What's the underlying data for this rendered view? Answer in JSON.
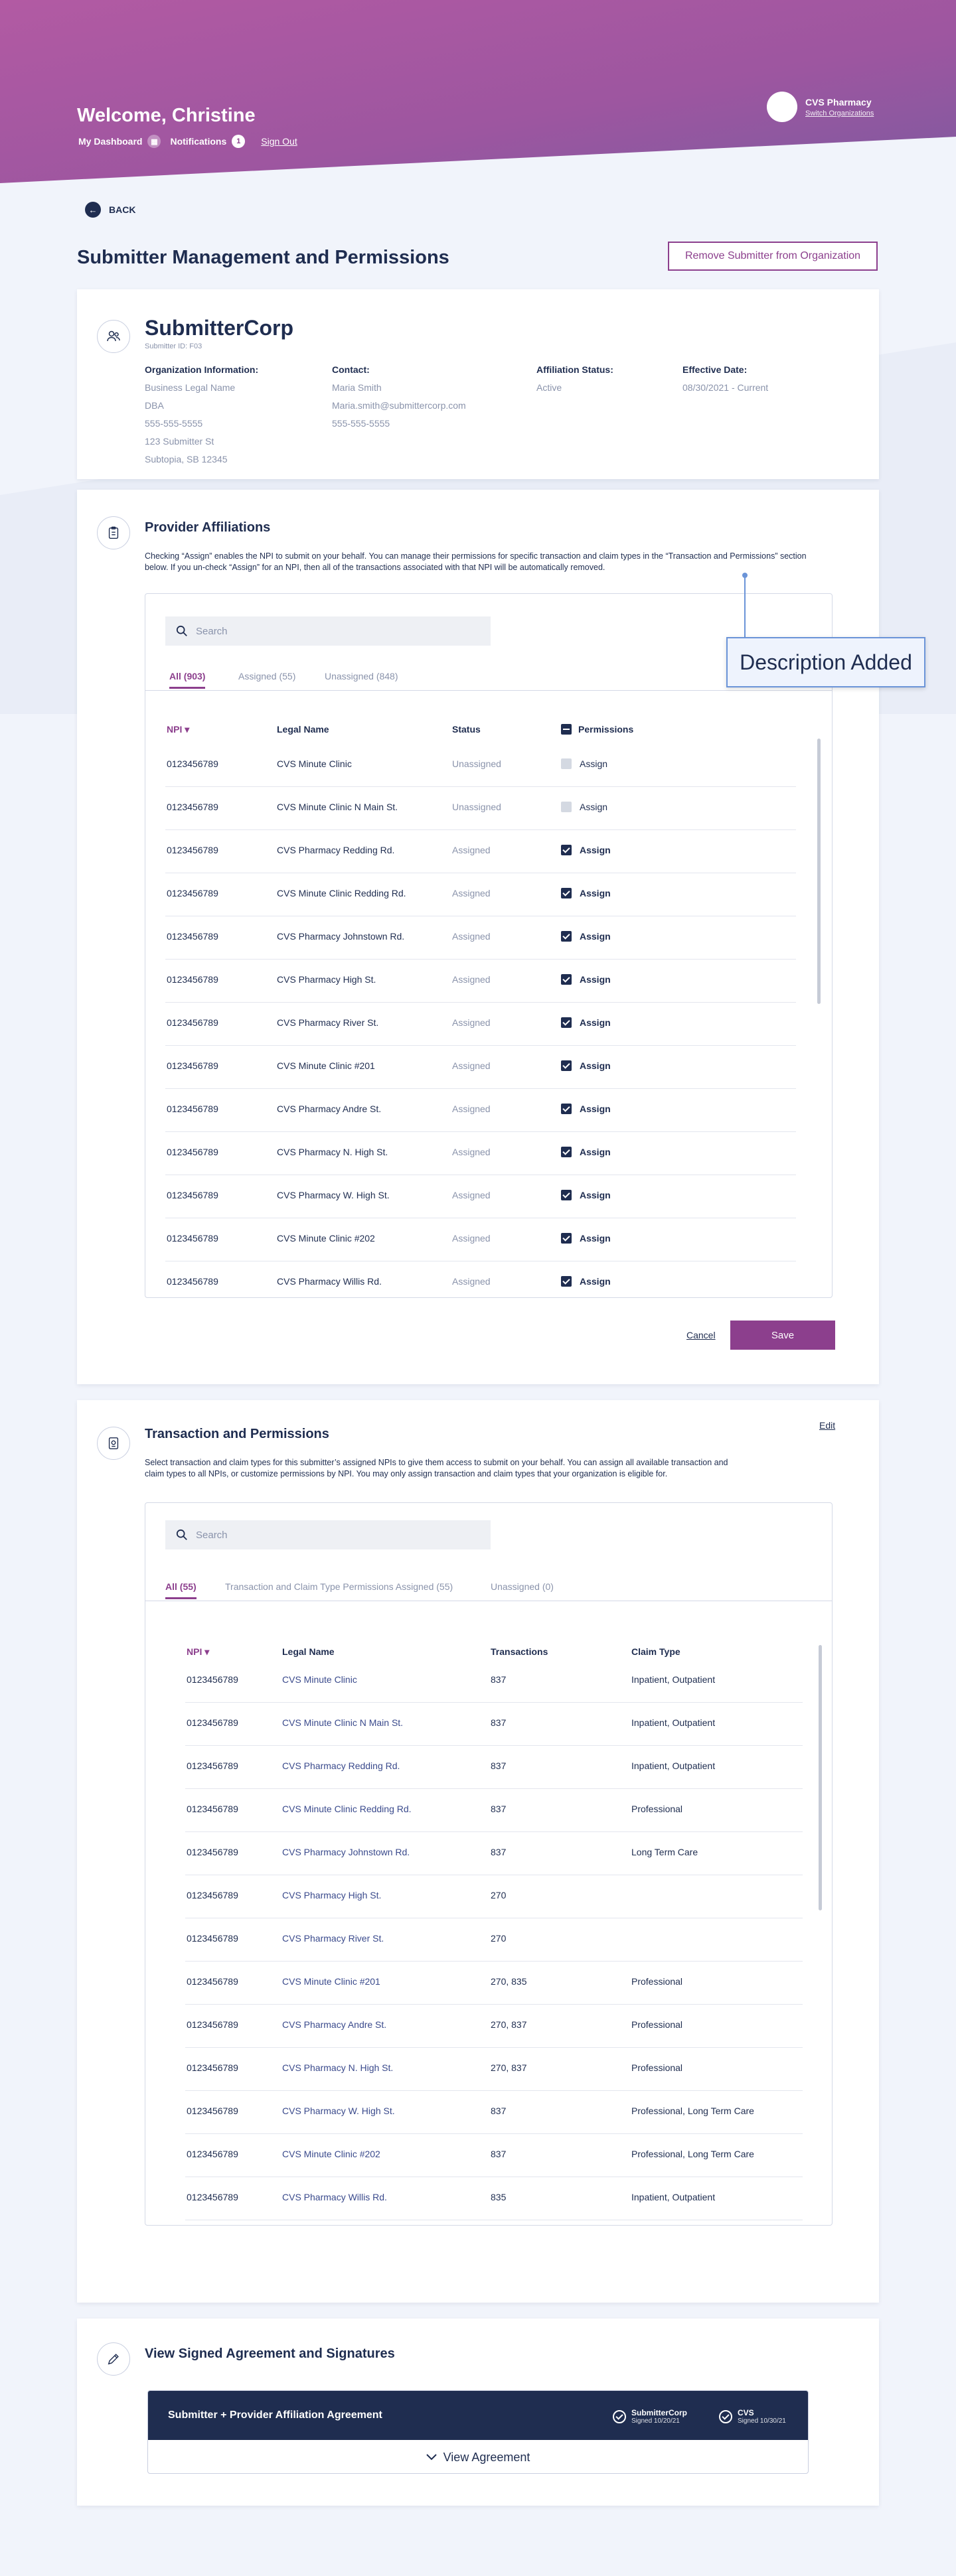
{
  "header": {
    "welcome": "Welcome, Christine",
    "dashboard": "My Dashboard",
    "notifications": "Notifications",
    "notifications_count": "1",
    "sign_out": "Sign Out",
    "org_name": "CVS Pharmacy",
    "switch_org": "Switch Organizations"
  },
  "back": "BACK",
  "page_title": "Submitter Management and Permissions",
  "remove_button": "Remove Submitter from Organization",
  "submitter": {
    "name": "SubmitterCorp",
    "id": "Submitter ID: F03",
    "org_info": {
      "heading": "Organization Information:",
      "lines": [
        "Business Legal Name",
        "DBA",
        "555-555-5555",
        "123 Submitter St",
        "Subtopia, SB 12345"
      ]
    },
    "contact": {
      "heading": "Contact:",
      "lines": [
        "Maria Smith",
        "Maria.smith@submittercorp.com",
        "555-555-5555"
      ]
    },
    "affiliation": {
      "heading": "Affiliation Status:",
      "value": "Active"
    },
    "effective": {
      "heading": "Effective Date:",
      "value": "08/30/2021 - Current"
    }
  },
  "provider": {
    "title": "Provider Affiliations",
    "desc": "Checking “Assign” enables the NPI to submit on your behalf. You can manage their permissions for specific transaction and claim types in the “Transaction and Permissions” section below. If you un-check “Assign” for an NPI, then all of the transactions associated with that NPI will be automatically removed.",
    "search_placeholder": "Search",
    "tabs": [
      "All (903)",
      "Assigned (55)",
      "Unassigned (848)"
    ],
    "columns": [
      "NPI",
      "Legal Name",
      "Status",
      "Permissions"
    ],
    "assign_label": "Assign",
    "rows": [
      {
        "npi": "0123456789",
        "name": "CVS Minute Clinic",
        "status": "Unassigned",
        "assigned": false
      },
      {
        "npi": "0123456789",
        "name": "CVS Minute Clinic N Main St.",
        "status": "Unassigned",
        "assigned": false
      },
      {
        "npi": "0123456789",
        "name": "CVS Pharmacy Redding Rd.",
        "status": "Assigned",
        "assigned": true
      },
      {
        "npi": "0123456789",
        "name": "CVS Minute Clinic Redding Rd.",
        "status": "Assigned",
        "assigned": true
      },
      {
        "npi": "0123456789",
        "name": "CVS Pharmacy Johnstown Rd.",
        "status": "Assigned",
        "assigned": true
      },
      {
        "npi": "0123456789",
        "name": "CVS Pharmacy High St.",
        "status": "Assigned",
        "assigned": true
      },
      {
        "npi": "0123456789",
        "name": "CVS Pharmacy River St.",
        "status": "Assigned",
        "assigned": true
      },
      {
        "npi": "0123456789",
        "name": "CVS Minute Clinic #201",
        "status": "Assigned",
        "assigned": true
      },
      {
        "npi": "0123456789",
        "name": "CVS Pharmacy Andre St.",
        "status": "Assigned",
        "assigned": true
      },
      {
        "npi": "0123456789",
        "name": "CVS Pharmacy N. High St.",
        "status": "Assigned",
        "assigned": true
      },
      {
        "npi": "0123456789",
        "name": "CVS Pharmacy W. High St.",
        "status": "Assigned",
        "assigned": true
      },
      {
        "npi": "0123456789",
        "name": "CVS Minute Clinic #202",
        "status": "Assigned",
        "assigned": true
      },
      {
        "npi": "0123456789",
        "name": "CVS Pharmacy Willis Rd.",
        "status": "Assigned",
        "assigned": true
      }
    ],
    "cancel": "Cancel",
    "save": "Save",
    "annotation": "Description Added"
  },
  "transactions": {
    "title": "Transaction and Permissions",
    "edit": "Edit",
    "desc": "Select transaction and claim types for this submitter’s assigned NPIs to give them access to submit on your behalf. You can assign all available transaction and claim types to all NPIs, or customize permissions by NPI. You may only assign transaction and claim types that your organization is eligible for.",
    "search_placeholder": "Search",
    "tabs": [
      "All (55)",
      "Transaction and Claim Type Permissions Assigned (55)",
      "Unassigned (0)"
    ],
    "columns": [
      "NPI",
      "Legal Name",
      "Transactions",
      "Claim Type"
    ],
    "rows": [
      {
        "npi": "0123456789",
        "name": "CVS Minute Clinic",
        "tx": "837",
        "claim": "Inpatient, Outpatient"
      },
      {
        "npi": "0123456789",
        "name": "CVS Minute Clinic N Main St.",
        "tx": "837",
        "claim": "Inpatient, Outpatient"
      },
      {
        "npi": "0123456789",
        "name": "CVS Pharmacy Redding Rd.",
        "tx": "837",
        "claim": "Inpatient, Outpatient"
      },
      {
        "npi": "0123456789",
        "name": "CVS Minute Clinic Redding Rd.",
        "tx": "837",
        "claim": "Professional"
      },
      {
        "npi": "0123456789",
        "name": "CVS Pharmacy Johnstown Rd.",
        "tx": "837",
        "claim": "Long Term Care"
      },
      {
        "npi": "0123456789",
        "name": "CVS Pharmacy High St.",
        "tx": "270",
        "claim": ""
      },
      {
        "npi": "0123456789",
        "name": "CVS Pharmacy River St.",
        "tx": "270",
        "claim": ""
      },
      {
        "npi": "0123456789",
        "name": "CVS Minute Clinic #201",
        "tx": "270, 835",
        "claim": "Professional"
      },
      {
        "npi": "0123456789",
        "name": "CVS Pharmacy Andre St.",
        "tx": "270, 837",
        "claim": "Professional"
      },
      {
        "npi": "0123456789",
        "name": "CVS Pharmacy N. High St.",
        "tx": "270, 837",
        "claim": "Professional"
      },
      {
        "npi": "0123456789",
        "name": "CVS Pharmacy W. High St.",
        "tx": "837",
        "claim": "Professional, Long Term Care"
      },
      {
        "npi": "0123456789",
        "name": "CVS Minute Clinic #202",
        "tx": "837",
        "claim": "Professional, Long Term Care"
      },
      {
        "npi": "0123456789",
        "name": "CVS Pharmacy Willis Rd.",
        "tx": "835",
        "claim": "Inpatient, Outpatient"
      }
    ]
  },
  "agreement": {
    "title": "View Signed Agreement and Signatures",
    "box_title": "Submitter + Provider Affiliation Agreement",
    "sig1_name": "SubmitterCorp",
    "sig1_date": "Signed 10/20/21",
    "sig2_name": "CVS",
    "sig2_date": "Signed 10/30/21",
    "view": "View Agreement"
  },
  "colors": {
    "brand": "#8c3f8d",
    "navy": "#1f2d50",
    "header_gradient_start": "#a24f9c",
    "header_gradient_end": "#7a5fa5"
  }
}
